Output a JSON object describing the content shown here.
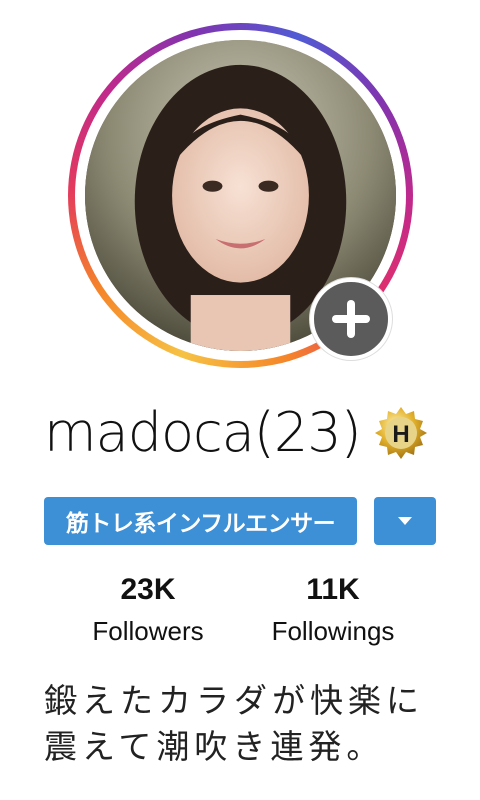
{
  "profile": {
    "username": "madoca(23)",
    "badge_letter": "H",
    "category": "筋トレ系インフルエンサー",
    "stats": {
      "followers_count": "23K",
      "followers_label": "Followers",
      "following_count": "11K",
      "following_label": "Followings"
    },
    "bio_lines": [
      "鍛えたカラダが快楽に",
      "震えて潮吹き連発。"
    ]
  },
  "icons": {
    "add": "plus-icon",
    "dropdown": "caret-down-icon",
    "badge": "gold-seal-icon"
  },
  "colors": {
    "accent": "#3d8fd6",
    "add_button": "#5b5b5b",
    "badge_gold": "#d9a521"
  }
}
